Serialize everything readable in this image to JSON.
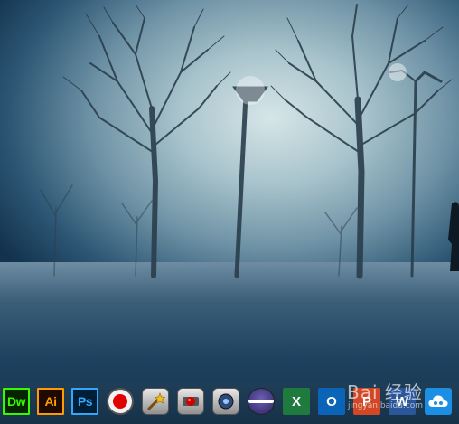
{
  "wallpaper": {
    "description_colors": {
      "sky": "#c7dbdf",
      "ground": "#1e425f"
    }
  },
  "taskbar": {
    "icons": [
      {
        "id": "dreamweaver",
        "label": "Dw",
        "color": "#35fa00"
      },
      {
        "id": "illustrator",
        "label": "Ai",
        "color": "#ff9a00"
      },
      {
        "id": "photoshop",
        "label": "Ps",
        "color": "#31a8ff"
      },
      {
        "id": "screen-recorder",
        "label": "",
        "color": "#e00000"
      },
      {
        "id": "magic-wand-tool",
        "label": "",
        "color": "#f0c020"
      },
      {
        "id": "record-tool",
        "label": "",
        "color": "#d00000"
      },
      {
        "id": "media-tool",
        "label": "",
        "color": "#2a4a7a"
      },
      {
        "id": "eclipse",
        "label": "",
        "color": "#2c2466"
      },
      {
        "id": "excel",
        "label": "X",
        "color": "#1e7a3d"
      },
      {
        "id": "outlook",
        "label": "O",
        "color": "#0a64b8"
      },
      {
        "id": "powerpoint",
        "label": "P",
        "color": "#d24726"
      },
      {
        "id": "word",
        "label": "W",
        "color": "#2b579a"
      },
      {
        "id": "cloud-sync",
        "label": "",
        "color": "#1a8fe3"
      }
    ]
  },
  "watermark": {
    "text": "Bai 经验",
    "url": "jingyan.baidu.com"
  }
}
